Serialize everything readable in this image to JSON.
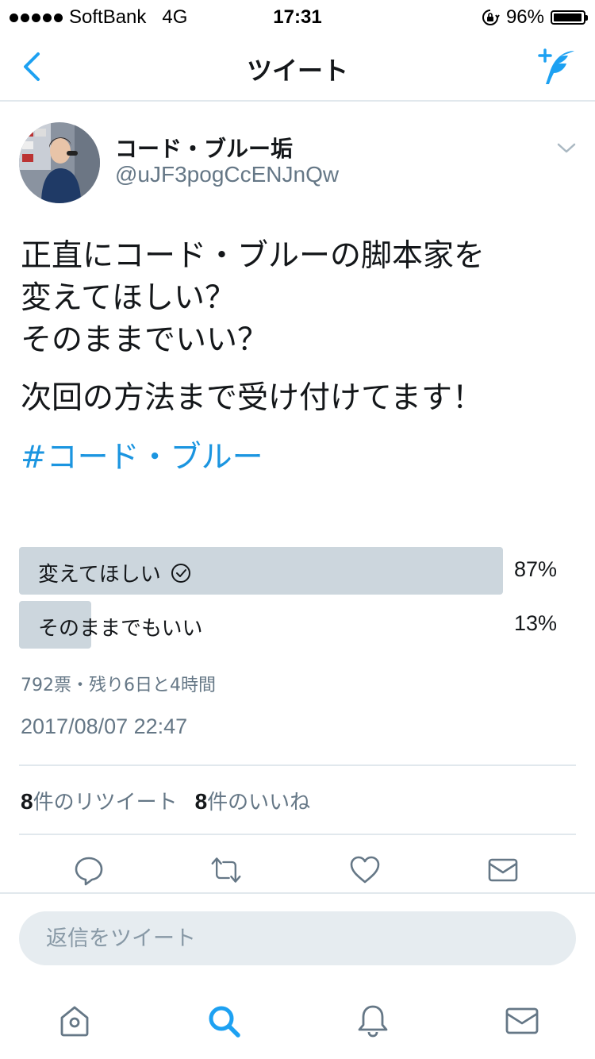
{
  "status_bar": {
    "carrier": "SoftBank",
    "network": "4G",
    "time": "17:31",
    "battery_percent": "96%",
    "battery_level": 0.96
  },
  "nav": {
    "title": "ツイート",
    "back_icon": "chevron-left-icon",
    "compose_icon": "compose-tweet-icon"
  },
  "tweet": {
    "display_name": "コード・ブルー垢",
    "handle": "@uJF3pogCcENJnQw",
    "text_lines": [
      "正直にコード・ブルーの脚本家を",
      "変えてほしい？",
      "そのままでいい？"
    ],
    "text_line2": "次回の方法まで受け付けてます！",
    "hashtag": "#コード・ブルー",
    "poll": {
      "options": [
        {
          "label": "変えてほしい",
          "percent_text": "87%",
          "percent": 87,
          "selected": true
        },
        {
          "label": "そのままでもいい",
          "percent_text": "13%",
          "percent": 13,
          "selected": false
        }
      ],
      "meta": "792票・残り6日と4時間"
    },
    "timestamp": "2017/08/07 22:47",
    "stats": {
      "retweets_count": "8",
      "retweets_label": "件のリツイート",
      "likes_count": "8",
      "likes_label": "件のいいね"
    }
  },
  "actions": {
    "icons": [
      "reply-icon",
      "retweet-icon",
      "like-icon",
      "direct-message-icon"
    ]
  },
  "reply": {
    "placeholder": "返信をツイート"
  },
  "tab_bar": {
    "icons": [
      "home-icon",
      "search-icon",
      "notifications-icon",
      "messages-icon"
    ],
    "active": "search-icon"
  },
  "colors": {
    "accent": "#1da1f2",
    "link": "#1b95e0",
    "secondary_text": "#657786",
    "poll_bar": "#ccd6dd",
    "icon_gray": "#657786"
  }
}
